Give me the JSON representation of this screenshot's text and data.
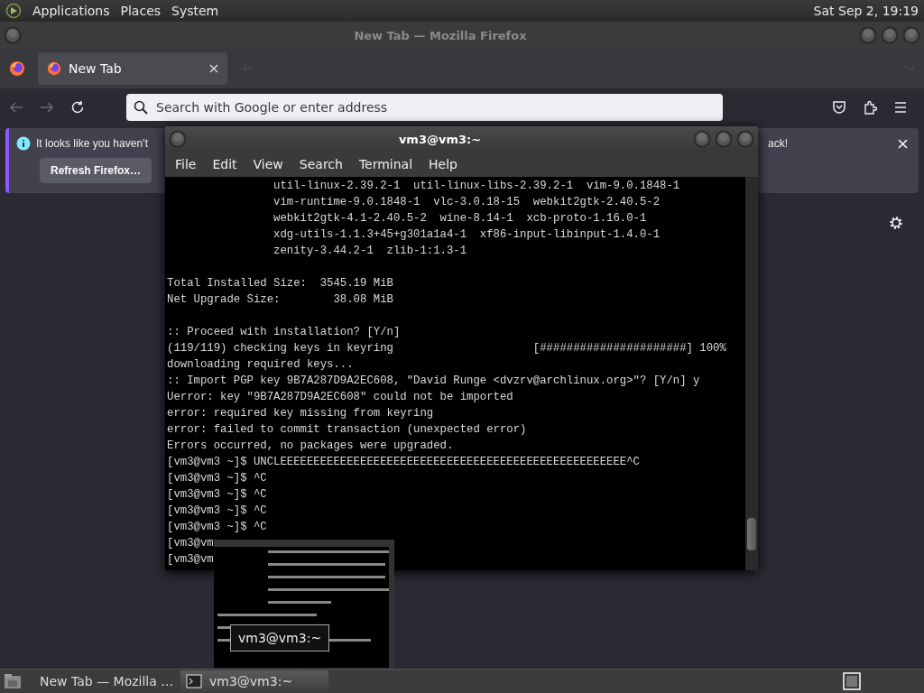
{
  "top_panel": {
    "menus": [
      "Applications",
      "Places",
      "System"
    ],
    "clock": "Sat Sep 2, 19:19"
  },
  "firefox": {
    "title": "New Tab — Mozilla Firefox",
    "tabs": [
      {
        "label": "New Tab",
        "selected": true
      }
    ],
    "address_bar": {
      "placeholder": "Search with Google or enter address"
    },
    "notification": {
      "message_start": "It looks like you haven’t",
      "message_end": "ack!",
      "button": "Refresh Firefox…"
    }
  },
  "terminal": {
    "title": "vm3@vm3:~",
    "menus": [
      "File",
      "Edit",
      "View",
      "Search",
      "Terminal",
      "Help"
    ],
    "lines": [
      {
        "text": "                util-linux-2.39.2-1  util-linux-libs-2.39.2-1  vim-9.0.1848-1"
      },
      {
        "text": "                vim-runtime-9.0.1848-1  vlc-3.0.18-15  webkit2gtk-2.40.5-2"
      },
      {
        "text": "                webkit2gtk-4.1-2.40.5-2  wine-8.14-1  xcb-proto-1.16.0-1"
      },
      {
        "text": "                xdg-utils-1.1.3+45+g301a1a4-1  xf86-input-libinput-1.4.0-1"
      },
      {
        "text": "                zenity-3.44.2-1  zlib-1:1.3-1"
      },
      {
        "text": "Total Installed Size:  3545.19 MiB",
        "blank_line_before": true
      },
      {
        "text": "Net Upgrade Size:        38.08 MiB"
      },
      {
        "text": ":: Proceed with installation? [Y/n]",
        "blank_line_before": true
      },
      {
        "text": "(119/119) checking keys in keyring                     [######################] 100%"
      },
      {
        "text": "downloading required keys..."
      },
      {
        "text": ":: Import PGP key 9B7A287D9A2EC608, \"David Runge <dvzrv@archlinux.org>\"? [Y/n] y"
      },
      {
        "text": "Uerror: key \"9B7A287D9A2EC608\" could not be imported"
      },
      {
        "text": "error: required key missing from keyring"
      },
      {
        "text": "error: failed to commit transaction (unexpected error)"
      },
      {
        "text": "Errors occurred, no packages were upgraded."
      },
      {
        "text": "[vm3@vm3 ~]$ UNCLEEEEEEEEEEEEEEEEEEEEEEEEEEEEEEEEEEEEEEEEEEEEEEEEEEEE^C"
      },
      {
        "text": "[vm3@vm3 ~]$ ^C"
      },
      {
        "text": "[vm3@vm3 ~]$ ^C"
      },
      {
        "text": "[vm3@vm3 ~]$ ^C"
      },
      {
        "text": "[vm3@vm3 ~]$ ^C"
      },
      {
        "text": "[vm3@vm"
      },
      {
        "text": "[vm3@vm"
      }
    ]
  },
  "preview": {
    "kind": "picture",
    "label": "vm3@vm3:~"
  },
  "taskbar": {
    "items": [
      {
        "kind": "browser",
        "label": "New Tab — Mozilla …",
        "selected": false
      },
      {
        "kind": "terminal",
        "label": "vm3@vm3:~",
        "selected": true
      }
    ]
  }
}
